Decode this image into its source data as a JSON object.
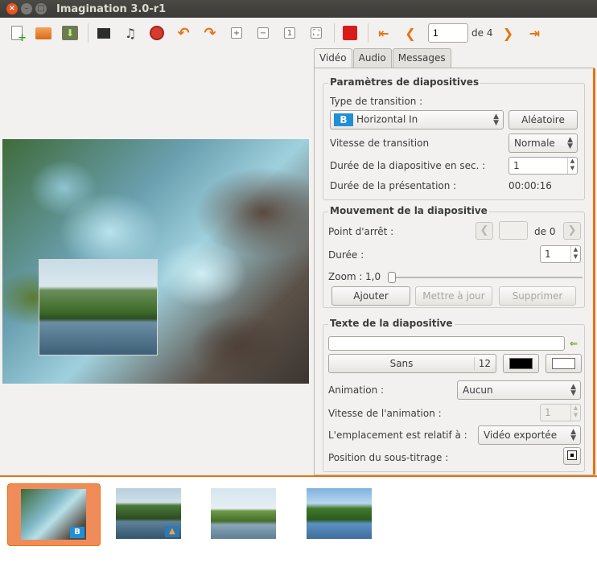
{
  "window": {
    "title": "Imagination 3.0-r1"
  },
  "toolbar": {
    "page_value": "1",
    "page_total": "de 4"
  },
  "tabs": [
    "Vidéo",
    "Audio",
    "Messages"
  ],
  "slide_settings": {
    "title": "Paramètres de diapositives",
    "transition_type_label": "Type de transition :",
    "transition_value": "Horizontal In",
    "transition_icon_letter": "B",
    "random_button": "Aléatoire",
    "transition_speed_label": "Vitesse de transition",
    "transition_speed_value": "Normale",
    "slide_duration_label": "Durée de la diapositive en sec. :",
    "slide_duration_value": "1",
    "presentation_duration_label": "Durée de la présentation :",
    "presentation_duration_value": "00:00:16"
  },
  "slide_motion": {
    "title": "Mouvement de la diapositive",
    "stop_point_label": "Point d'arrêt :",
    "stop_point_of": "de 0",
    "duration_label": "Durée :",
    "duration_value": "1",
    "zoom_label": "Zoom :",
    "zoom_value": "1,0",
    "zoom_level": 0,
    "add_button": "Ajouter",
    "update_button": "Mettre à jour",
    "delete_button": "Supprimer"
  },
  "slide_text": {
    "title": "Texte de la diapositive",
    "text_value": "",
    "font_name": "Sans",
    "font_size": "12",
    "font_color": "#000000",
    "bg_color": "#ffffff",
    "animation_label": "Animation :",
    "animation_value": "Aucun",
    "animation_speed_label": "Vitesse de l'animation :",
    "animation_speed_value": "1",
    "placement_label": "L'emplacement est relatif à :",
    "placement_value": "Vidéo exportée",
    "subtitle_position_label": "Position du sous-titrage :"
  },
  "filmstrip": {
    "thumb1_badge": "B"
  },
  "colors": {
    "accent": "#e8720c",
    "close": "#e95420"
  }
}
